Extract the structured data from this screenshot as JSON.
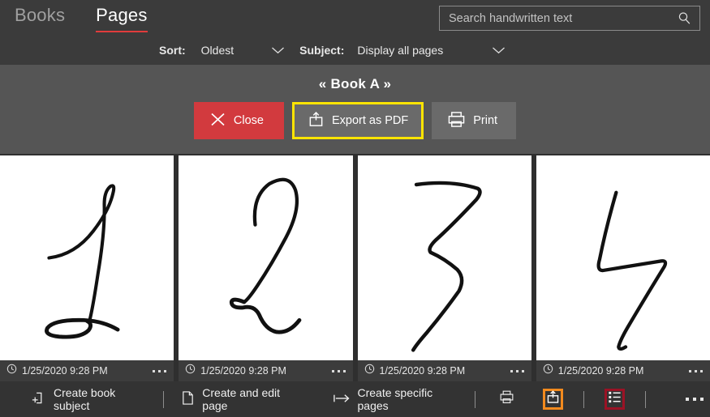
{
  "topbar": {
    "tabs": [
      {
        "label": "Books",
        "active": false
      },
      {
        "label": "Pages",
        "active": true
      }
    ],
    "search": {
      "placeholder": "Search handwritten text",
      "value": "",
      "icon": "search-icon"
    },
    "filters": {
      "sort_label": "Sort:",
      "sort_value": "Oldest",
      "subject_label": "Subject:",
      "subject_value": "Display all pages"
    }
  },
  "book": {
    "title": "« Book A »",
    "buttons": [
      {
        "label": "Close",
        "icon": "close-x-icon",
        "style": "red"
      },
      {
        "label": "Export as PDF",
        "icon": "share-export-icon",
        "style": "gray",
        "highlight": "#ffe400"
      },
      {
        "label": "Print",
        "icon": "printer-icon",
        "style": "gray"
      }
    ]
  },
  "pages": [
    {
      "glyph": "1",
      "timestamp": "1/25/2020 9:28 PM",
      "clock_icon": "clock-icon",
      "menu_icon": "more-dots-icon"
    },
    {
      "glyph": "2",
      "timestamp": "1/25/2020 9:28 PM",
      "clock_icon": "clock-icon",
      "menu_icon": "more-dots-icon"
    },
    {
      "glyph": "3",
      "timestamp": "1/25/2020 9:28 PM",
      "clock_icon": "clock-icon",
      "menu_icon": "more-dots-icon"
    },
    {
      "glyph": "4",
      "timestamp": "1/25/2020 9:28 PM",
      "clock_icon": "clock-icon",
      "menu_icon": "more-dots-icon"
    }
  ],
  "bottombar": {
    "create_book_subject": "Create book subject",
    "create_and_edit_page": "Create and edit page",
    "create_specific_pages": "Create specific pages",
    "icons": {
      "book_subject": "new-book-subject-icon",
      "edit_page": "page-icon",
      "specific_pages": "arrow-right-from-bar-icon",
      "print": "printer-icon",
      "share": "share-export-icon",
      "list": "list-view-icon",
      "overflow": "more-dots-icon"
    },
    "highlights": {
      "share_border": "#f28a1e",
      "list_border": "#9b1225"
    }
  },
  "colors": {
    "topbar_bg": "#3b3b3b",
    "book_header_bg": "#555555",
    "page_bg": "#2f2f2f",
    "bottom_bar_bg": "#333333",
    "accent_red": "#e03c3c",
    "close_red": "#d23a3e",
    "button_gray": "#6a6a6a",
    "card_footer_bg": "#3c3c3c"
  }
}
